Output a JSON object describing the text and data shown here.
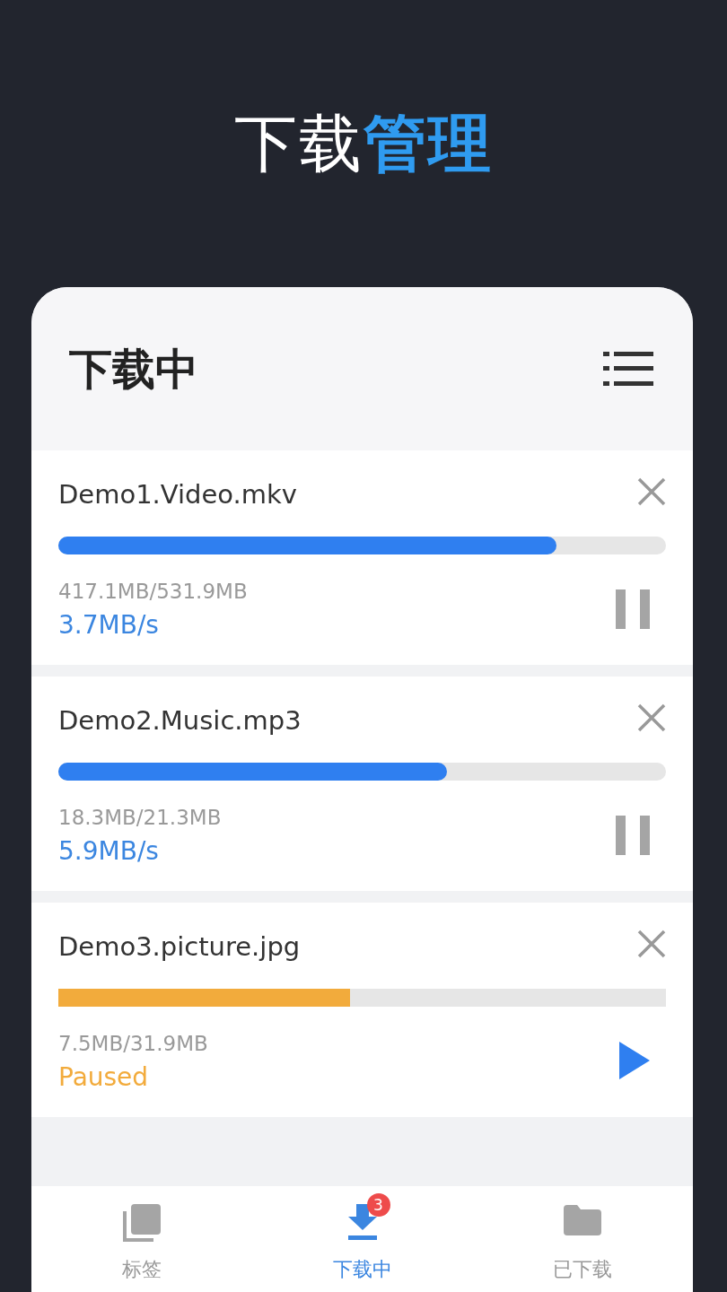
{
  "headline": "下载**管理**",
  "panel": {
    "title": "下载中"
  },
  "downloads": [
    {
      "name": "Demo1.Video.mkv",
      "level": 0.82,
      "size": "417.1MB/531.9MB",
      "status": "3.7MB/s",
      "paused": false
    },
    {
      "name": "Demo2.Music.mp3",
      "level": 0.64,
      "size": "18.3MB/21.3MB",
      "status": "5.9MB/s",
      "paused": false
    },
    {
      "name": "Demo3.picture.jpg",
      "level": 0.48,
      "size": "7.5MB/31.9MB",
      "status": "Paused",
      "paused": true
    }
  ],
  "bottom_nav": [
    {
      "label": "标签",
      "kind": "stack",
      "selected": false
    },
    {
      "label": "下载中",
      "kind": "download",
      "selected": true,
      "badge": "3"
    },
    {
      "label": "已下载",
      "kind": "folder",
      "selected": false
    }
  ]
}
